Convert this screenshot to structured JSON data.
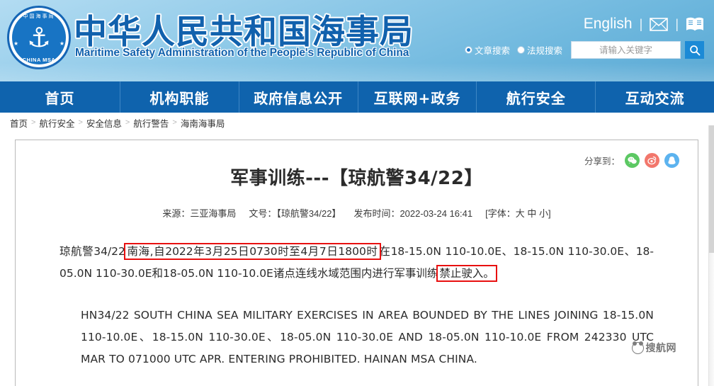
{
  "site": {
    "title_cn": "中华人民共和国海事局",
    "title_en": "Maritime Safety Administration of the People's Republic of China",
    "emblem": {
      "ring_text_cn": "中国海事局",
      "bottom_text": "CHINA MSA",
      "anchor_glyph": "⚓"
    }
  },
  "header": {
    "english_link": "English",
    "separator": "|",
    "mail_icon": "mail-icon",
    "book_icon": "book-icon"
  },
  "search": {
    "options": [
      {
        "label": "文章搜索",
        "selected": true
      },
      {
        "label": "法规搜索",
        "selected": false
      }
    ],
    "placeholder": "请输入关键字",
    "value": "",
    "button_icon": "search-icon"
  },
  "nav": {
    "items": [
      {
        "label": "首页"
      },
      {
        "label": "机构职能"
      },
      {
        "label": "政府信息公开"
      },
      {
        "label": "互联网+政务"
      },
      {
        "label": "航行安全"
      },
      {
        "label": "互动交流"
      }
    ]
  },
  "breadcrumb": {
    "separator": ">",
    "items": [
      {
        "label": "首页"
      },
      {
        "label": "航行安全"
      },
      {
        "label": "安全信息"
      },
      {
        "label": "航行警告"
      },
      {
        "label": "海南海事局"
      }
    ]
  },
  "share": {
    "label": "分享到：",
    "targets": [
      {
        "name": "wechat",
        "icon": "wechat-icon",
        "color": "#5cc863"
      },
      {
        "name": "weibo",
        "icon": "weibo-icon",
        "color": "#f2776c"
      },
      {
        "name": "qq",
        "icon": "qq-icon",
        "color": "#5cb3ef"
      }
    ]
  },
  "article": {
    "title": "军事训练---【琼航警34/22】",
    "meta": {
      "source_label": "来源：",
      "source_value": "三亚海事局",
      "docno_label": "文号：",
      "docno_value": "【琼航警34/22】",
      "publish_label": "发布时间：",
      "publish_value": "2022-03-24 16:41",
      "fontsize_open": "[字体：",
      "fontsize_large": "大",
      "fontsize_medium": "中",
      "fontsize_small": "小",
      "fontsize_close": "]"
    },
    "body_cn": {
      "prefix": "琼航警34/22",
      "highlight_1": "南海,自2022年3月25日0730时至4月7日1800时",
      "middle": "在18-15.0N 110-10.0E、18-15.0N 110-30.0E、18-05.0N 110-30.0E和18-05.0N 110-10.0E诸点连线水域范围内进行军事训练",
      "highlight_2": "禁止驶入。"
    },
    "body_en": "HN34/22 SOUTH CHINA SEA MILITARY EXERCISES IN AREA BOUNDED BY THE LINES JOINING 18-15.0N 110-10.0E、18-15.0N 110-30.0E、18-05.0N 110-30.0E AND 18-05.0N 110-10.0E FROM 242330 UTC MAR TO 071000 UTC APR. ENTERING PROHIBITED. HAINAN MSA CHINA."
  },
  "watermark": {
    "text": "搜航网"
  },
  "colors": {
    "nav_blue": "#0f63ad",
    "title_blue": "#1161ad",
    "highlight_red": "#e81010",
    "search_button": "#1b8ad6"
  }
}
